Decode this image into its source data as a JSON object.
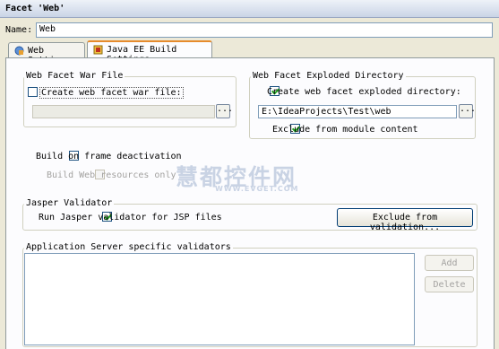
{
  "window": {
    "title": "Facet 'Web'"
  },
  "name_field": {
    "label": "Name:",
    "value": "Web"
  },
  "tabs": [
    {
      "label": "Web Settings",
      "icon": "web-settings-icon",
      "active": false
    },
    {
      "label": "Java EE Build Settings",
      "icon": "javaee-build-icon",
      "active": true
    }
  ],
  "war_group": {
    "title": "Web Facet War File",
    "checkbox_label": "Create web facet war file:",
    "checked": false,
    "path_value": "",
    "browse_label": "..."
  },
  "exploded_group": {
    "title": "Web Facet Exploded Directory",
    "checkbox_label": "Create web facet exploded directory:",
    "checked": true,
    "path_value": "E:\\IdeaProjects\\Test\\web",
    "browse_label": "...",
    "exclude_label": "Exclude from module content",
    "exclude_checked": true
  },
  "build_on_frame": {
    "label": "Build on frame deactivation",
    "checked": false
  },
  "build_web_only": {
    "label": "Build Web resources only",
    "checked": false
  },
  "jasper_group": {
    "title": "Jasper Validator",
    "checkbox_label": "Run Jasper validator for JSP files",
    "checked": true,
    "exclude_button": "Exclude from validation..."
  },
  "validators_group": {
    "title": "Application Server specific validators",
    "add_button": "Add",
    "delete_button": "Delete"
  },
  "watermark": {
    "main": "慧都控件网",
    "sub": "WWW.EVGET.COM"
  }
}
